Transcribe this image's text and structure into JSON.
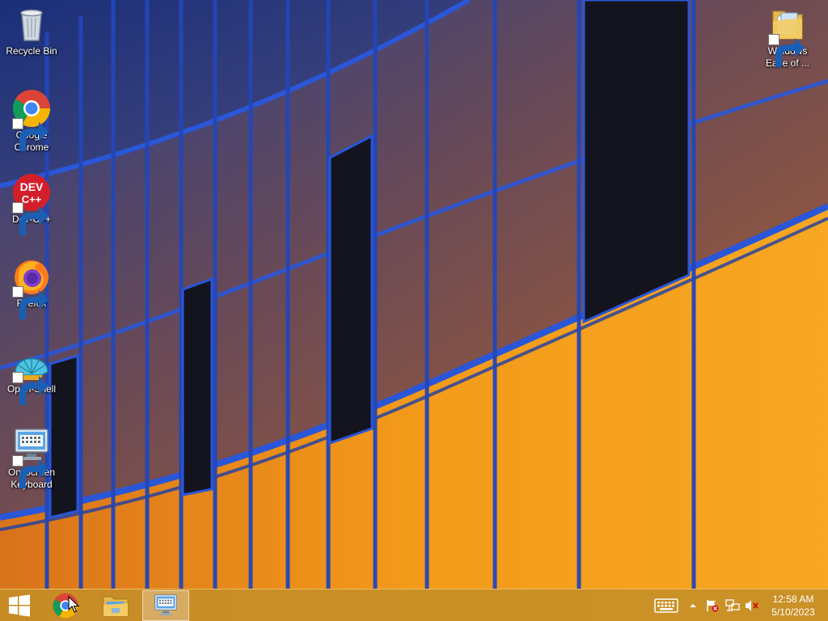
{
  "desktop": {
    "icons": [
      {
        "label": "Recycle Bin",
        "icon": "recycle-bin-icon"
      },
      {
        "label": "Google Chrome",
        "icon": "chrome-icon"
      },
      {
        "label": "Dev-C++",
        "icon": "devcpp-icon"
      },
      {
        "label": "Firefox",
        "icon": "firefox-icon"
      },
      {
        "label": "Open-Shell",
        "icon": "open-shell-icon"
      },
      {
        "label": "On-Screen Keyboard",
        "icon": "keyboard-icon"
      },
      {
        "label": "Windows Ease of ...",
        "icon": "folder-icon"
      }
    ],
    "devcpp_logo_text": "DEV C++"
  },
  "taskbar": {
    "pinned": [
      {
        "name": "Start",
        "icon": "windows-logo-icon"
      },
      {
        "name": "Google Chrome",
        "icon": "chrome-icon"
      },
      {
        "name": "File Explorer",
        "icon": "file-explorer-icon"
      },
      {
        "name": "On-Screen Keyboard",
        "icon": "keyboard-icon",
        "active": true
      }
    ],
    "tray": {
      "icons": [
        "touch-keyboard-icon",
        "show-hidden-icons-chevron",
        "action-center-flag-icon",
        "network-icon",
        "volume-muted-icon"
      ],
      "time": "12:58 AM",
      "date": "5/10/2023"
    }
  },
  "colors": {
    "taskbar": "#c48e28",
    "wallpaper_blue": "#1e3f9a",
    "wallpaper_orange": "#f39a1a"
  }
}
